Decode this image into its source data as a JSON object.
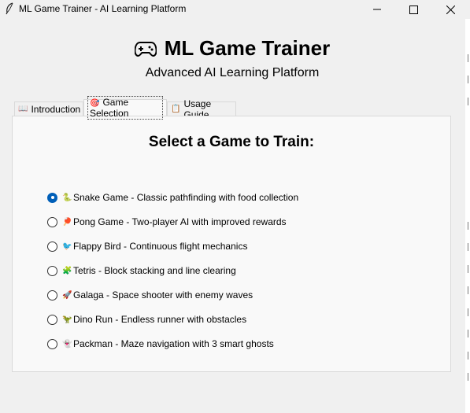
{
  "window": {
    "title": "ML Game Trainer - AI Learning Platform",
    "icon": "feather-icon"
  },
  "header": {
    "icon": "gamepad-icon",
    "title": "ML Game Trainer",
    "subtitle": "Advanced AI Learning Platform"
  },
  "tabs": [
    {
      "label": "Introduction",
      "icon": "book-icon",
      "selected": false
    },
    {
      "label": "Game Selection",
      "icon": "target-icon",
      "selected": true
    },
    {
      "label": "Usage Guide",
      "icon": "clipboard-icon",
      "selected": false
    }
  ],
  "game_selection": {
    "heading": "Select a Game to Train:",
    "selected_index": 0,
    "games": [
      {
        "label": "Snake Game - Classic pathfinding with food collection",
        "icon": "snake-icon"
      },
      {
        "label": "Pong Game - Two-player AI with improved rewards",
        "icon": "ping-pong-icon"
      },
      {
        "label": "Flappy Bird - Continuous flight mechanics",
        "icon": "bird-icon"
      },
      {
        "label": "Tetris - Block stacking and line clearing",
        "icon": "blocks-icon"
      },
      {
        "label": "Galaga - Space shooter with enemy waves",
        "icon": "rocket-icon"
      },
      {
        "label": "Dino Run - Endless runner with obstacles",
        "icon": "dinosaur-icon"
      },
      {
        "label": "Packman - Maze navigation with 3 smart ghosts",
        "icon": "ghost-icon"
      }
    ]
  }
}
